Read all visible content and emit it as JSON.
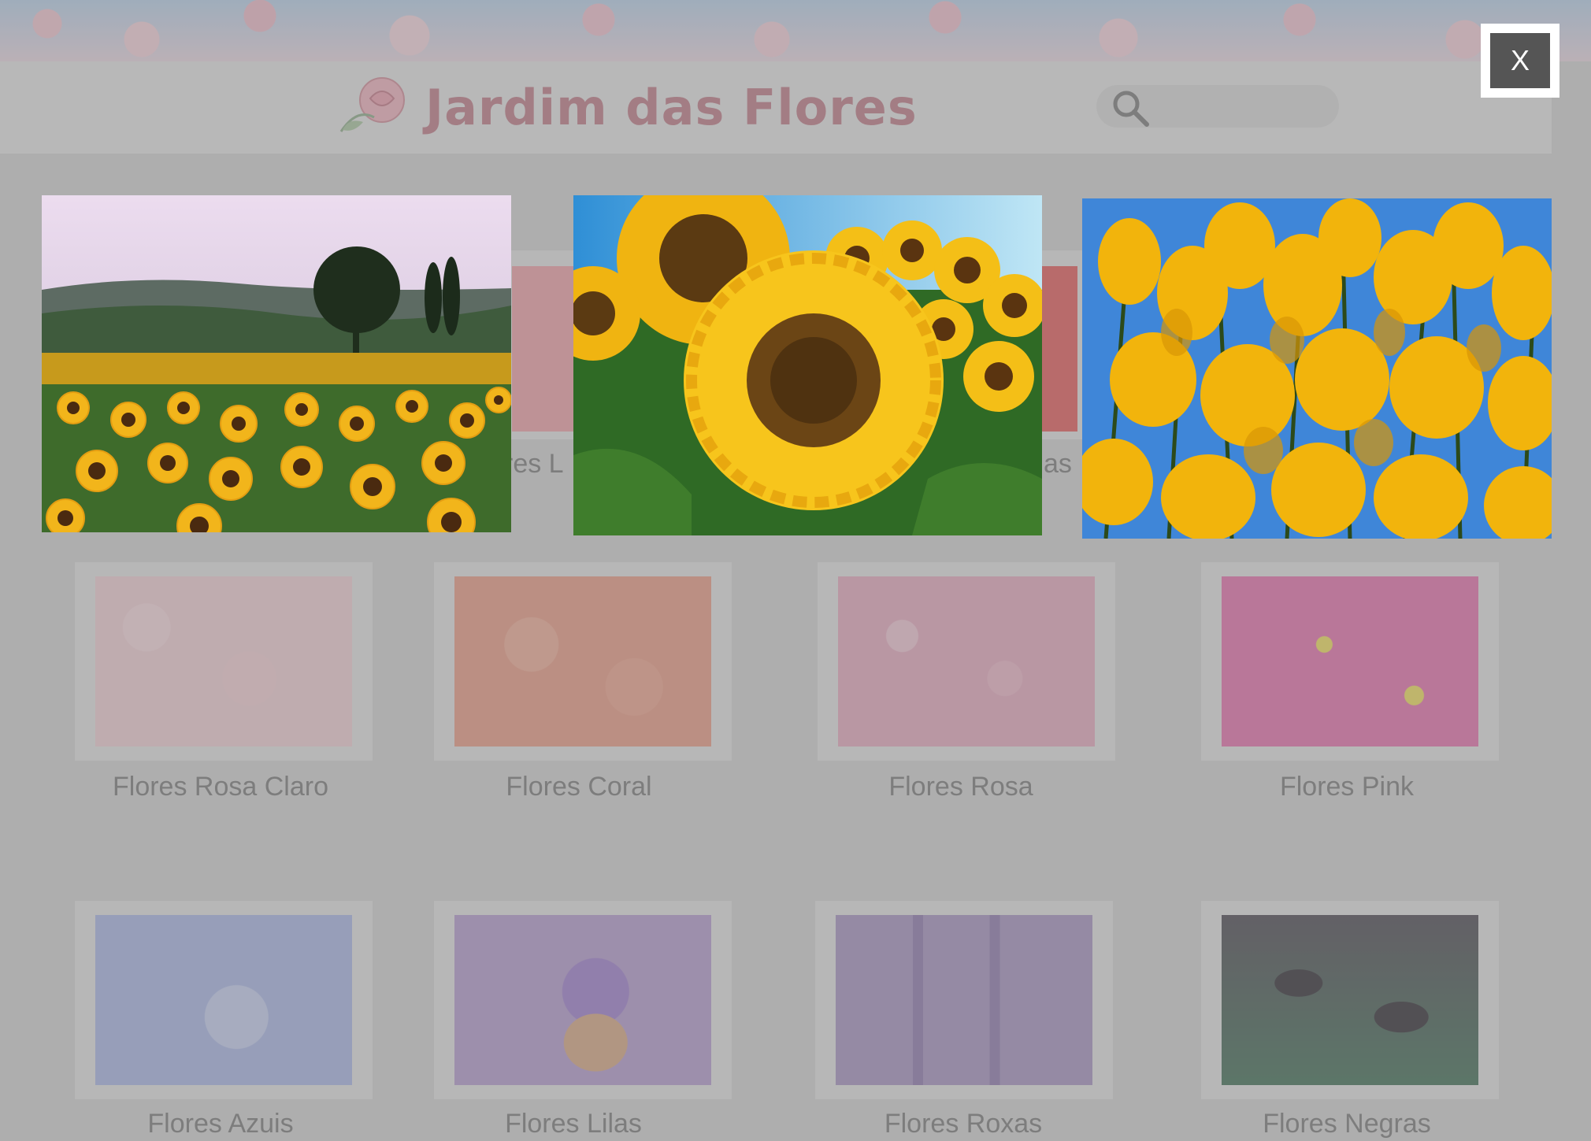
{
  "header": {
    "title": "Jardim das Flores",
    "search": {
      "placeholder": "",
      "icon": "search-icon"
    },
    "logo": "rose-logo"
  },
  "background_cards_partial": {
    "left_caption_fragment": "res L",
    "right_caption_fragment": "as"
  },
  "categories": [
    {
      "label": "Flores Rosa Claro",
      "color": "#f3cfd6"
    },
    {
      "label": "Flores Coral",
      "color": "#ec9c86"
    },
    {
      "label": "Flores Rosa",
      "color": "#e7a9c0"
    },
    {
      "label": "Flores Pink",
      "color": "#e86fae"
    },
    {
      "label": "Flores Azuis",
      "color": "#a9b6e8"
    },
    {
      "label": "Flores Lilas",
      "color": "#b59bd0"
    },
    {
      "label": "Flores Roxas",
      "color": "#a793c2"
    },
    {
      "label": "Flores Negras",
      "color": "#4b4650"
    }
  ],
  "lightbox": {
    "close_label": "X",
    "photos": [
      {
        "name": "sunflower-field-photo"
      },
      {
        "name": "sunflower-closeup-photo"
      },
      {
        "name": "yellow-broom-flowers-photo"
      }
    ]
  }
}
